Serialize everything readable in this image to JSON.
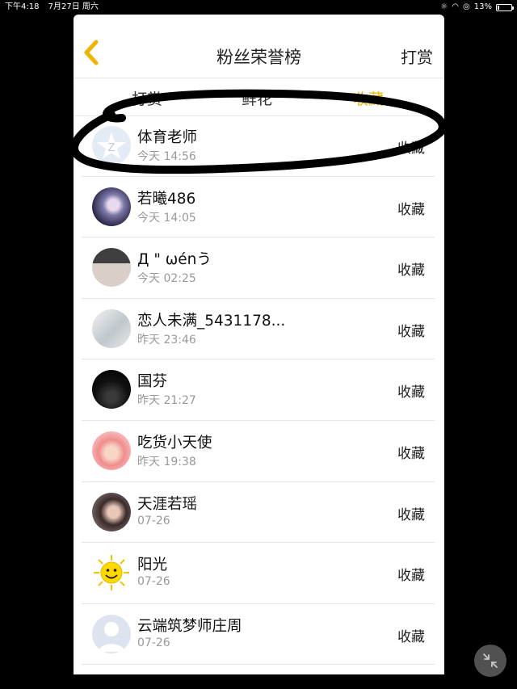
{
  "status": {
    "time": "下午4:18",
    "date": "7月27日 周六",
    "battery": "13%",
    "battery_level": 0.13
  },
  "nav": {
    "title": "粉丝荣誉榜",
    "right_button": "打赏"
  },
  "tabs": [
    {
      "label": "打赏",
      "active": false
    },
    {
      "label": "鲜花",
      "active": false
    },
    {
      "label": "收藏",
      "active": true
    }
  ],
  "rows": [
    {
      "name": "体育老师",
      "time": "今天 14:56",
      "action": "收藏",
      "avatar_icon": "default-star-avatar"
    },
    {
      "name": "若曦486",
      "time": "今天 14:05",
      "action": "收藏",
      "avatar_icon": "anime-avatar"
    },
    {
      "name": "Д \" ωénう",
      "time": "今天 02:25",
      "action": "收藏",
      "avatar_icon": "photo-avatar"
    },
    {
      "name": "恋人未满_5431178...",
      "time": "昨天 23:46",
      "action": "收藏",
      "avatar_icon": "sketch-avatar"
    },
    {
      "name": "国芬",
      "time": "昨天 21:27",
      "action": "收藏",
      "avatar_icon": "dark-avatar"
    },
    {
      "name": "吃货小天使",
      "time": "昨天 19:38",
      "action": "收藏",
      "avatar_icon": "girl-avatar"
    },
    {
      "name": "天涯若瑶",
      "time": "07-26",
      "action": "收藏",
      "avatar_icon": "portrait-avatar"
    },
    {
      "name": "阳光",
      "time": "07-26",
      "action": "收藏",
      "avatar_icon": "sun-avatar"
    },
    {
      "name": "云端筑梦师庄周",
      "time": "07-26",
      "action": "收藏",
      "avatar_icon": "default-person-avatar"
    }
  ],
  "colors": {
    "accent": "#f0b400",
    "background": "#000000",
    "text": "#222222",
    "subtext": "#999999"
  }
}
